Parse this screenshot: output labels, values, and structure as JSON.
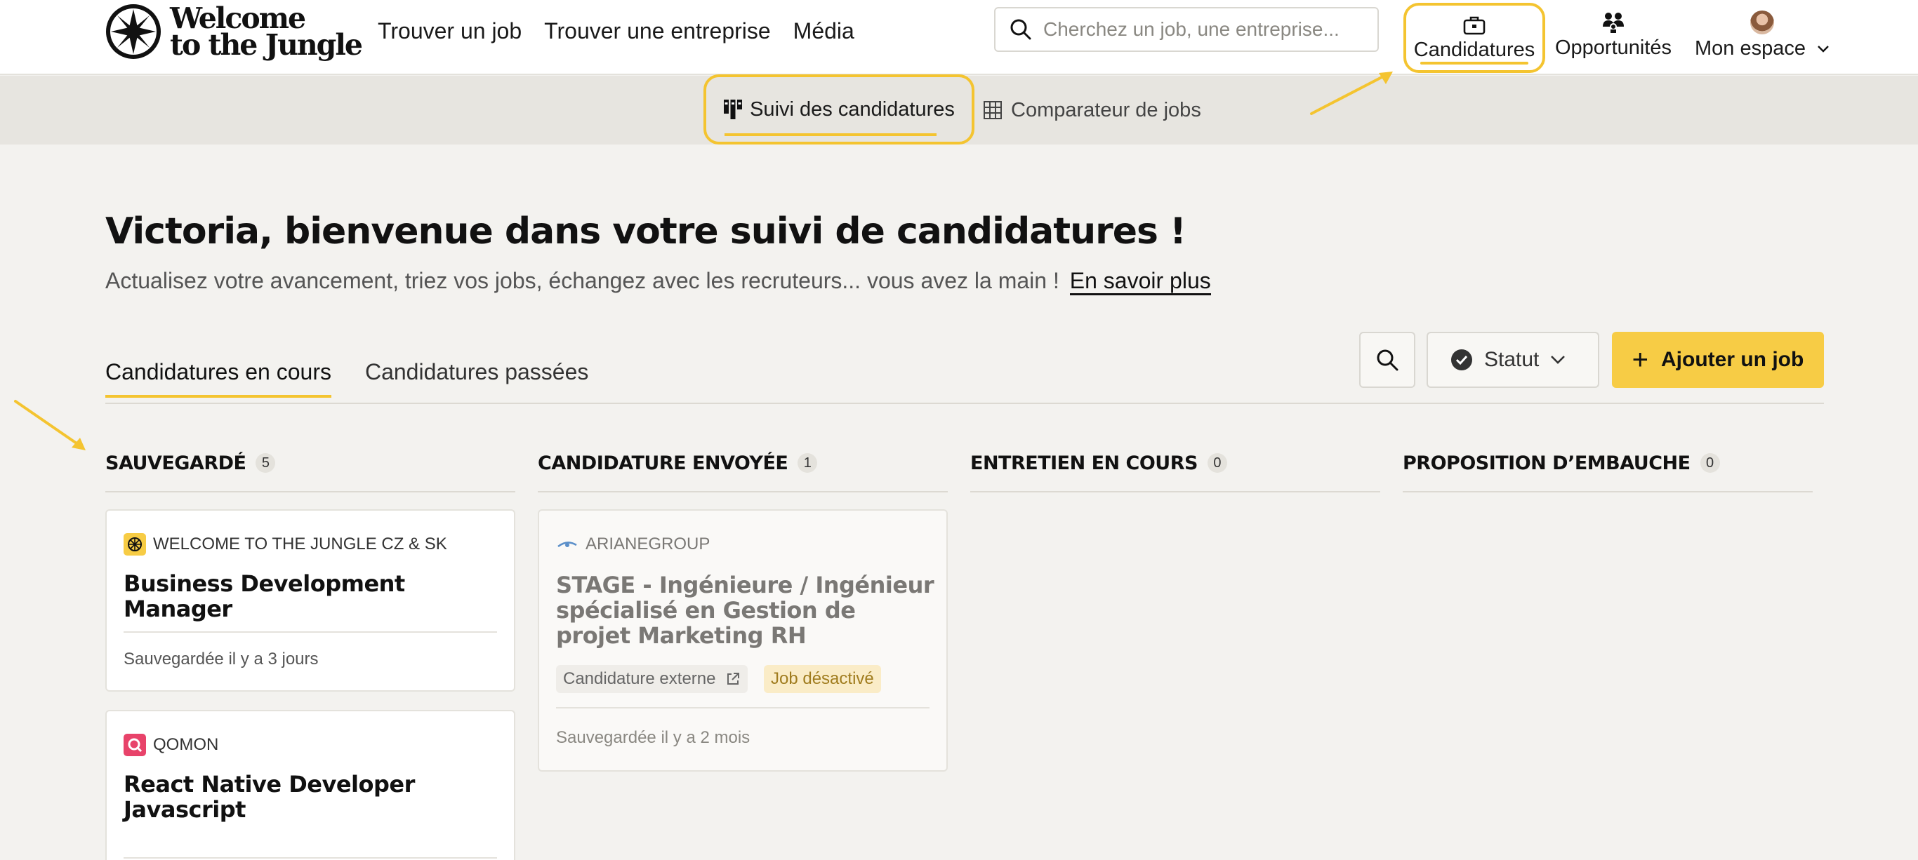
{
  "header": {
    "logo_line1": "Welcome",
    "logo_line2": "to the Jungle",
    "nav": [
      "Trouver un job",
      "Trouver une entreprise",
      "Média"
    ],
    "search_placeholder": "Cherchez un job, une entreprise...",
    "candidatures_label": "Candidatures",
    "opportunites_label": "Opportunités",
    "mon_espace_label": "Mon espace"
  },
  "subnav": {
    "suivi_label": "Suivi des candidatures",
    "comparateur_label": "Comparateur de jobs"
  },
  "main": {
    "title": "Victoria, bienvenue dans votre suivi de candidatures !",
    "subtitle": "Actualisez votre avancement, triez vos jobs, échangez avec les recruteurs... vous avez la main !",
    "learn_more": "En savoir plus",
    "tabs": [
      "Candidatures en cours",
      "Candidatures passées"
    ],
    "status_label": "Statut",
    "add_job_label": "Ajouter un job"
  },
  "columns": [
    {
      "title": "SAUVEGARDÉ",
      "count": "5"
    },
    {
      "title": "CANDIDATURE ENVOYÉE",
      "count": "1"
    },
    {
      "title": "ENTRETIEN EN COURS",
      "count": "0"
    },
    {
      "title": "PROPOSITION D’EMBAUCHE",
      "count": "0"
    }
  ],
  "cards": [
    {
      "company": "WELCOME TO THE JUNGLE CZ & SK",
      "title": "Business Development Manager",
      "footer": "Sauvegardée il y a 3 jours"
    },
    {
      "company": "QOMON",
      "title": "React Native Developer Javascript",
      "footer": ""
    },
    {
      "company": "ARIANEGROUP",
      "title": "STAGE - Ingénieure / Ingénieur spécialisé en Gestion de projet Marketing RH",
      "tag_external": "Candidature externe",
      "tag_disabled": "Job désactivé",
      "footer": "Sauvegardée il y a 2 mois"
    }
  ],
  "colors": {
    "accent": "#f4c430",
    "button": "#f7cc45",
    "background": "#f3f2ef"
  }
}
